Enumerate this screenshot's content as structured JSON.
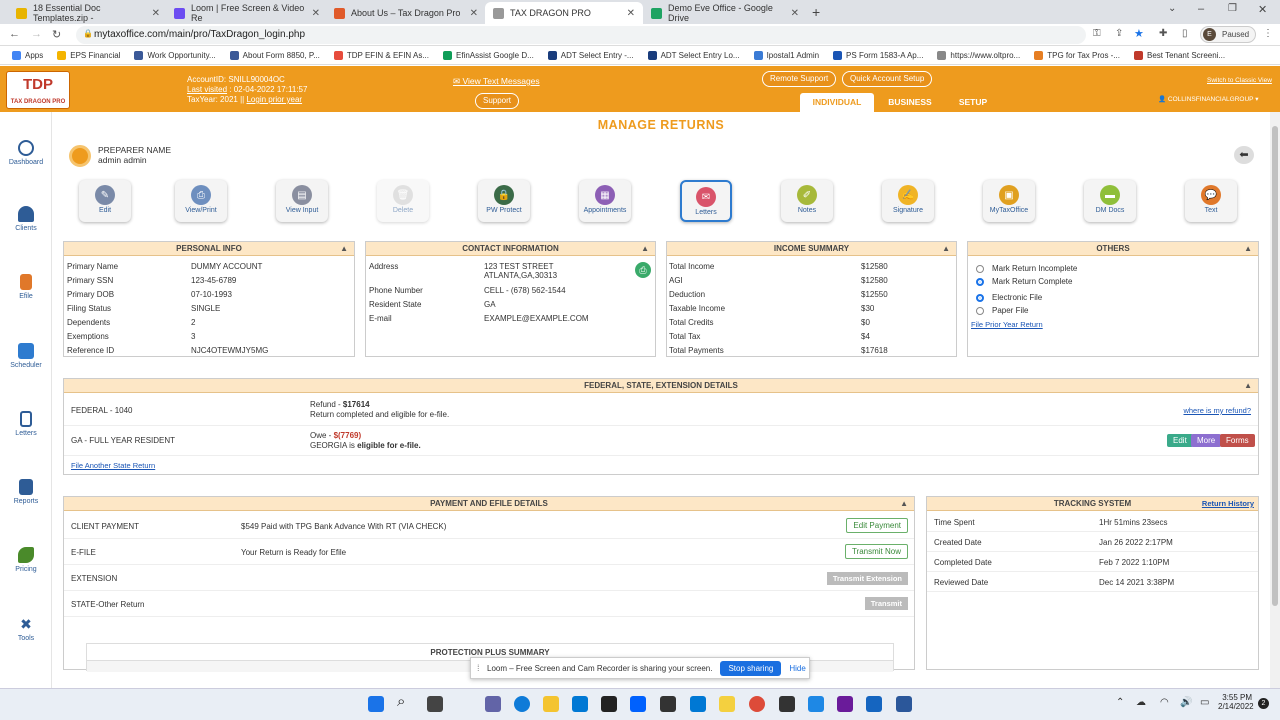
{
  "browser": {
    "tabs": [
      {
        "title": "18 Essential Doc Templates.zip -",
        "color": "#e8b400"
      },
      {
        "title": "Loom | Free Screen & Video Re",
        "color": "#6c4cf1"
      },
      {
        "title": "About Us – Tax Dragon Pro",
        "color": "#e05a2a"
      },
      {
        "title": "TAX DRAGON PRO",
        "color": "#999999"
      },
      {
        "title": "Demo Eve Office - Google Drive",
        "color": "#1ea362"
      }
    ],
    "url": "mytaxoffice.com/main/pro/TaxDragon_login.php",
    "profile": "Paused",
    "profile_initial": "E",
    "bookmarks": [
      "Apps",
      "EPS Financial",
      "Work Opportunity...",
      "About Form 8850, P...",
      "TDP EFIN & EFIN As...",
      "EfinAssist Google D...",
      "ADT Select Entry -...",
      "ADT Select Entry Lo...",
      "Ipostal1 Admin",
      "PS Form 1583-A Ap...",
      "https://www.oltpro...",
      "TPG for Tax Pros -...",
      "Best Tenant Screeni..."
    ]
  },
  "header": {
    "logo": "TDP",
    "logo_sub": "TAX DRAGON PRO",
    "account_line": "AccountID:  SNILL90004OC",
    "last_visited_label": "Last visited",
    "last_visited_value": " : 02-04-2022 17:11:57",
    "taxyear_line": "TaxYear:  2021  ||",
    "login_prior": "Login prior year",
    "view_text": "✉ View Text Messages",
    "support": "Support",
    "remote_support": "Remote Support",
    "quick_setup": "Quick Account Setup",
    "classic_view": "Switch to Classic View",
    "tabs": [
      "INDIVIDUAL",
      "BUSINESS",
      "SETUP"
    ],
    "user": "COLLINSFINANCIALGROUP ▾"
  },
  "sidebar": [
    "Dashboard",
    "Clients",
    "Efile",
    "Scheduler",
    "Letters",
    "Reports",
    "Pricing",
    "Tools"
  ],
  "page_title": "MANAGE RETURNS",
  "preparer": {
    "label": "PREPARER NAME",
    "name": "admin admin"
  },
  "toolbar": [
    {
      "label": "Edit",
      "color": "#7a8aa8"
    },
    {
      "label": "View/Print",
      "color": "#6e8fbf"
    },
    {
      "label": "View Input",
      "color": "#8a8fa0"
    },
    {
      "label": "Delete",
      "color": "#c8c8c8"
    },
    {
      "label": "PW Protect",
      "color": "#3b6b48"
    },
    {
      "label": "Appointments",
      "color": "#8d5fb5"
    },
    {
      "label": "Letters",
      "color": "#d9546a"
    },
    {
      "label": "Notes",
      "color": "#a7b93a"
    },
    {
      "label": "Signature",
      "color": "#f0b426"
    },
    {
      "label": "MyTaxOffice",
      "color": "#e0a020"
    },
    {
      "label": "DM Docs",
      "color": "#8fbf3a"
    },
    {
      "label": "Text",
      "color": "#e0782a"
    }
  ],
  "personal_info": {
    "title": "PERSONAL INFO",
    "rows": [
      [
        "Primary Name",
        "DUMMY ACCOUNT"
      ],
      [
        "Primary SSN",
        "123-45-6789"
      ],
      [
        "Primary DOB",
        "07-10-1993"
      ],
      [
        "Filing Status",
        "SINGLE"
      ],
      [
        "Dependents",
        "2"
      ],
      [
        "Exemptions",
        "3"
      ],
      [
        "Reference ID",
        "NJC4OTEWMJY5MG"
      ]
    ]
  },
  "contact_info": {
    "title": "CONTACT INFORMATION",
    "address_label": "Address",
    "address_1": "123 TEST STREET",
    "address_2": "ATLANTA,GA,30313",
    "rows": [
      [
        "Phone Number",
        "CELL - (678) 562-1544"
      ],
      [
        "Resident State",
        "GA"
      ],
      [
        "E-mail",
        "EXAMPLE@EXAMPLE.COM"
      ]
    ]
  },
  "income_summary": {
    "title": "INCOME SUMMARY",
    "rows": [
      [
        "Total Income",
        "$12580"
      ],
      [
        "AGI",
        "$12580"
      ],
      [
        "Deduction",
        "$12550"
      ],
      [
        "Taxable Income",
        "$30"
      ],
      [
        "Total Credits",
        "$0"
      ],
      [
        "Total Tax",
        "$4"
      ],
      [
        "Total Payments",
        "$17618"
      ]
    ]
  },
  "others": {
    "title": "OTHERS",
    "options": [
      "Mark Return Incomplete",
      "Mark Return Complete",
      "Electronic File",
      "Paper File"
    ],
    "link": "File Prior Year Return"
  },
  "federal": {
    "title": "FEDERAL, STATE, EXTENSION DETAILS",
    "fed_label": "FEDERAL - 1040",
    "fed_prefix": "Refund - ",
    "fed_amount": "$17614",
    "fed_status": "Return completed and eligible for e-file.",
    "where_refund": "where is my refund?",
    "state_label": "GA - FULL YEAR RESIDENT",
    "state_prefix": "Owe - ",
    "state_amount": "$(7769)",
    "state_status_1": "GEORGIA is ",
    "state_status_2": "eligible for e-file.",
    "btn_edit": "Edit",
    "btn_more": "More",
    "btn_forms": "Forms",
    "another_state": "File Another State Return"
  },
  "payment": {
    "title": "PAYMENT AND EFILE DETAILS",
    "rows": [
      {
        "label": "CLIENT PAYMENT",
        "value": "$549 Paid with TPG Bank Advance With RT (VIA CHECK)",
        "button": "Edit Payment"
      },
      {
        "label": "E-FILE",
        "value": "Your Return is Ready for Efile",
        "button": "Transmit Now"
      },
      {
        "label": "EXTENSION",
        "value": "",
        "button": "Transmit Extension"
      },
      {
        "label": "STATE-Other Return",
        "value": "",
        "button": "Transmit"
      }
    ],
    "protection": "PROTECTION PLUS SUMMARY"
  },
  "tracking": {
    "title": "TRACKING SYSTEM",
    "history": "Return History",
    "rows": [
      [
        "Time Spent",
        "1Hr 51mins 23secs"
      ],
      [
        "Created Date",
        "Jan 26 2022 2:17PM"
      ],
      [
        "Completed Date",
        "Feb 7 2022 1:10PM"
      ],
      [
        "Reviewed Date",
        "Dec 14 2021 3:38PM"
      ]
    ]
  },
  "loom": {
    "text": "Loom – Free Screen and Cam Recorder is sharing your screen.",
    "stop": "Stop sharing",
    "hide": "Hide"
  },
  "taskbar": {
    "time": "3:55 PM",
    "date": "2/14/2022"
  }
}
